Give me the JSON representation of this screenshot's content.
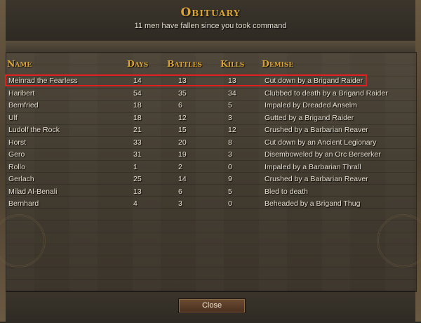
{
  "header": {
    "title": "Obituary",
    "subtitle": "11 men have fallen since you took command"
  },
  "columns": {
    "name": "Name",
    "days": "Days",
    "battles": "Battles",
    "kills": "Kills",
    "demise": "Demise"
  },
  "rows": [
    {
      "name": "Meinrad the Fearless",
      "days": "14",
      "battles": "13",
      "kills": "13",
      "demise": "Cut down by a Brigand Raider"
    },
    {
      "name": "Haribert",
      "days": "54",
      "battles": "35",
      "kills": "34",
      "demise": "Clubbed to death by a Brigand Raider"
    },
    {
      "name": "Bernfried",
      "days": "18",
      "battles": "6",
      "kills": "5",
      "demise": "Impaled by Dreaded Anselm"
    },
    {
      "name": "Ulf",
      "days": "18",
      "battles": "12",
      "kills": "3",
      "demise": "Gutted by a Brigand Raider"
    },
    {
      "name": "Ludolf the Rock",
      "days": "21",
      "battles": "15",
      "kills": "12",
      "demise": "Crushed by a Barbarian Reaver"
    },
    {
      "name": "Horst",
      "days": "33",
      "battles": "20",
      "kills": "8",
      "demise": "Cut down by an Ancient Legionary"
    },
    {
      "name": "Gero",
      "days": "31",
      "battles": "19",
      "kills": "3",
      "demise": "Disemboweled by an Orc Berserker"
    },
    {
      "name": "Rollo",
      "days": "1",
      "battles": "2",
      "kills": "0",
      "demise": "Impaled by a Barbarian Thrall"
    },
    {
      "name": "Gerlach",
      "days": "25",
      "battles": "14",
      "kills": "9",
      "demise": "Crushed by a Barbarian Reaver"
    },
    {
      "name": "Milad Al-Benali",
      "days": "13",
      "battles": "6",
      "kills": "5",
      "demise": "Bled to death"
    },
    {
      "name": "Bernhard",
      "days": "4",
      "battles": "3",
      "kills": "0",
      "demise": "Beheaded by a Brigand Thug"
    }
  ],
  "footer": {
    "close_label": "Close"
  },
  "colors": {
    "title": "#d9a437",
    "text": "#e7dfcf",
    "highlight": "#e02020"
  }
}
